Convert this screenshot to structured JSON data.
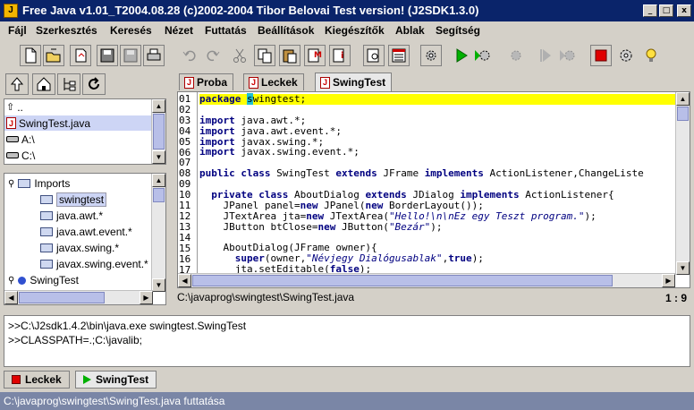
{
  "window": {
    "title": "Free Java v1.01_T2004.08.28 (c)2002-2004 Tibor Belovai   Test version! (J2SDK1.3.0)",
    "app_icon": "J",
    "minimize": "_",
    "maximize": "□",
    "close": "x"
  },
  "menu": [
    "Fájl",
    "Szerkesztés",
    "Keresés",
    "Nézet",
    "Futtatás",
    "Beállítások",
    "Kiegészítők",
    "Ablak",
    "Segítség"
  ],
  "toolbar_icons": [
    "new-file-icon",
    "open-file-icon",
    "reload-icon",
    "save-icon",
    "save-all-icon",
    "print-icon",
    "undo-icon",
    "redo-icon",
    "cut-icon",
    "copy-icon",
    "paste-icon",
    "mark-icon",
    "info-icon",
    "preview-icon",
    "class-view-icon",
    "compile-icon",
    "run-icon",
    "run-gear-icon",
    "debug-icon",
    "step-icon",
    "step-gear-icon",
    "stop-icon",
    "settings-icon",
    "hint-icon"
  ],
  "file_list": {
    "items": [
      {
        "icon": "up-arrow-icon",
        "label": ".."
      },
      {
        "icon": "java-file-icon",
        "label": "SwingTest.java",
        "selected": true
      },
      {
        "icon": "drive-icon",
        "label": "A:\\"
      },
      {
        "icon": "drive-icon",
        "label": "C:\\"
      }
    ]
  },
  "tree": {
    "imports_label": "Imports",
    "import_items": [
      "swingtest",
      "java.awt.*",
      "java.awt.event.*",
      "javax.swing.*",
      "javax.swing.event.*"
    ],
    "class_label": "SwingTest"
  },
  "editor_tabs": [
    {
      "label": "Proba",
      "active": false
    },
    {
      "label": "Leckek",
      "active": false
    },
    {
      "label": "SwingTest",
      "active": true
    }
  ],
  "code_lines": [
    "01",
    "02",
    "03",
    "04",
    "05",
    "06",
    "07",
    "08",
    "09",
    "10",
    "11",
    "12",
    "13",
    "14",
    "15",
    "16",
    "17"
  ],
  "code": [
    {
      "parts": [
        [
          "kw",
          "package "
        ],
        [
          "cur",
          "s"
        ],
        [
          "",
          "wingtest;"
        ]
      ],
      "hl": true
    },
    {
      "parts": []
    },
    {
      "parts": [
        [
          "kw",
          "import"
        ],
        [
          "",
          " java.awt.*;"
        ]
      ]
    },
    {
      "parts": [
        [
          "kw",
          "import"
        ],
        [
          "",
          " java.awt.event.*;"
        ]
      ]
    },
    {
      "parts": [
        [
          "kw",
          "import"
        ],
        [
          "",
          " javax.swing.*;"
        ]
      ]
    },
    {
      "parts": [
        [
          "kw",
          "import"
        ],
        [
          "",
          " javax.swing.event.*;"
        ]
      ]
    },
    {
      "parts": []
    },
    {
      "parts": [
        [
          "kw",
          "public class"
        ],
        [
          "",
          " SwingTest "
        ],
        [
          "kw",
          "extends"
        ],
        [
          "",
          " JFrame "
        ],
        [
          "kw",
          "implements"
        ],
        [
          "",
          " ActionListener,ChangeListe"
        ]
      ]
    },
    {
      "parts": []
    },
    {
      "parts": [
        [
          "",
          "  "
        ],
        [
          "kw",
          "private class"
        ],
        [
          "",
          " AboutDialog "
        ],
        [
          "kw",
          "extends"
        ],
        [
          "",
          " JDialog "
        ],
        [
          "kw",
          "implements"
        ],
        [
          "",
          " ActionListener{"
        ]
      ]
    },
    {
      "parts": [
        [
          "",
          "    JPanel panel="
        ],
        [
          "kw",
          "new"
        ],
        [
          "",
          " JPanel("
        ],
        [
          "kw",
          "new"
        ],
        [
          "",
          " BorderLayout());"
        ]
      ]
    },
    {
      "parts": [
        [
          "",
          "    JTextArea jta="
        ],
        [
          "kw",
          "new"
        ],
        [
          "",
          " JTextArea("
        ],
        [
          "str",
          "\"Hello!\\n\\nEz egy Teszt program.\""
        ],
        [
          "",
          ");"
        ]
      ]
    },
    {
      "parts": [
        [
          "",
          "    JButton btClose="
        ],
        [
          "kw",
          "new"
        ],
        [
          "",
          " JButton("
        ],
        [
          "str",
          "\"Bezár\""
        ],
        [
          "",
          ");"
        ]
      ]
    },
    {
      "parts": []
    },
    {
      "parts": [
        [
          "",
          "    AboutDialog(JFrame owner){"
        ]
      ]
    },
    {
      "parts": [
        [
          "",
          "      "
        ],
        [
          "kw",
          "super"
        ],
        [
          "",
          "(owner,"
        ],
        [
          "str",
          "\"Névjegy Dialógusablak\""
        ],
        [
          "",
          ","
        ],
        [
          "kw",
          "true"
        ],
        [
          "",
          ");"
        ]
      ]
    },
    {
      "parts": [
        [
          "",
          "      jta.setEditable("
        ],
        [
          "kw",
          "false"
        ],
        [
          "",
          ");"
        ]
      ]
    }
  ],
  "path": "C:\\javaprog\\swingtest\\SwingTest.java",
  "cursor_pos": "1 : 9",
  "output": [
    ">>C:\\J2sdk1.4.2\\bin\\java.exe swingtest.SwingTest",
    ">>CLASSPATH=.;C:\\javalib;"
  ],
  "bottom_tabs": [
    {
      "label": "Leckek",
      "icon": "stop-square-icon",
      "active": false
    },
    {
      "label": "SwingTest",
      "icon": "run-triangle-icon",
      "active": true
    }
  ],
  "status": "C:\\javaprog\\swingtest\\SwingTest.java futtatása",
  "colors": {
    "title_bar": "#0a246a",
    "highlight_line": "#ffff00",
    "status_bar": "#7a86a6",
    "keyword": "#000080"
  }
}
